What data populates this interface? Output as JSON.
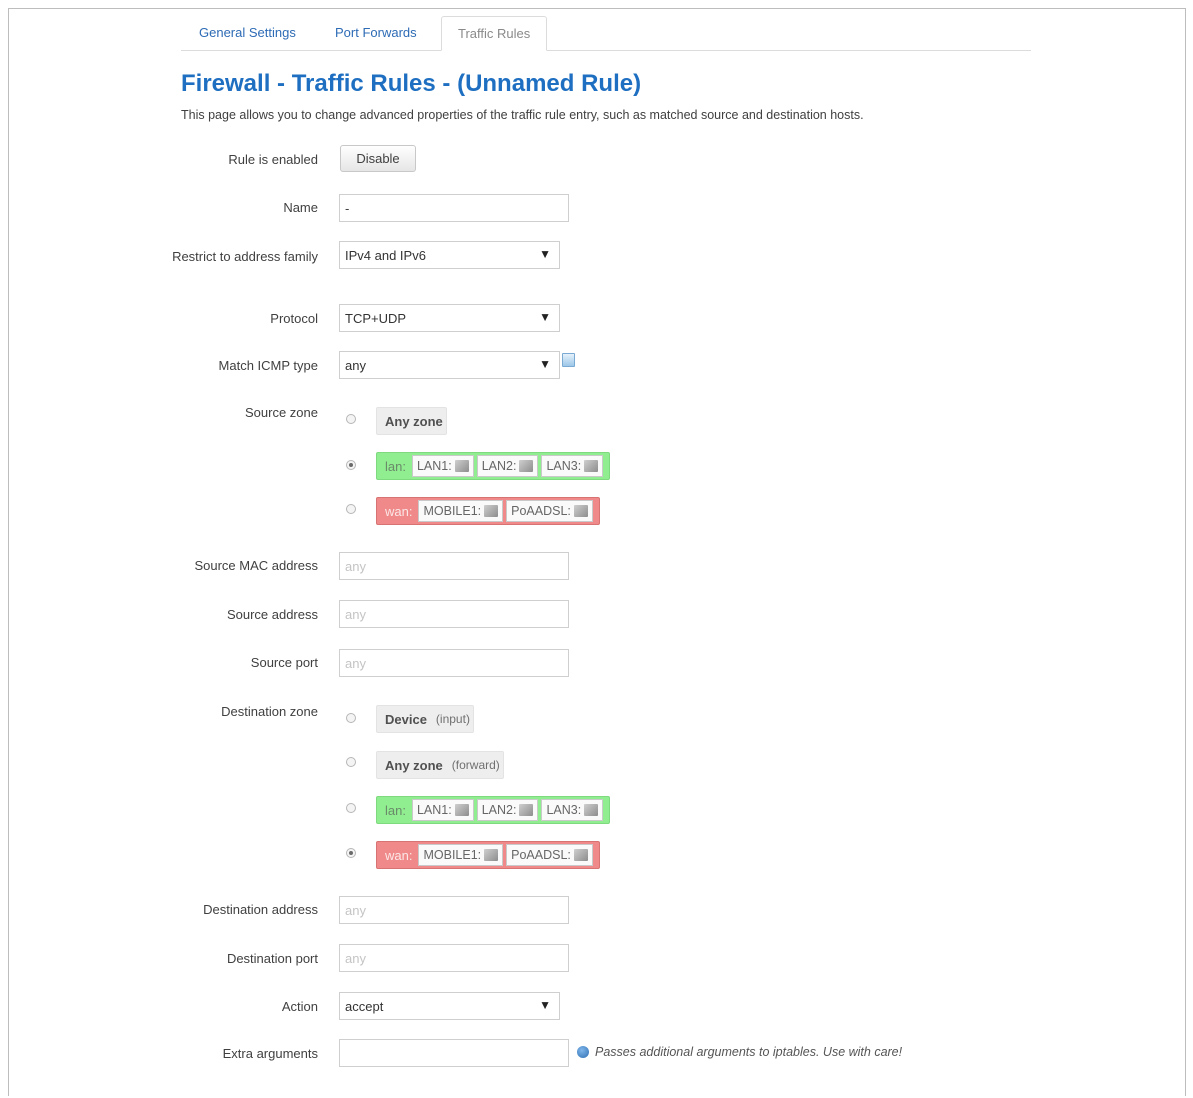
{
  "tabs": [
    {
      "label": "General Settings"
    },
    {
      "label": "Port Forwards"
    },
    {
      "label": "Traffic Rules"
    }
  ],
  "page": {
    "title": "Firewall - Traffic Rules - (Unnamed Rule)",
    "description": "This page allows you to change advanced properties of the traffic rule entry, such as matched source and destination hosts."
  },
  "form": {
    "enabled": {
      "label": "Rule is enabled",
      "button": "Disable"
    },
    "name": {
      "label": "Name",
      "value": "-"
    },
    "family": {
      "label": "Restrict to address family",
      "value": "IPv4 and IPv6"
    },
    "protocol": {
      "label": "Protocol",
      "value": "TCP+UDP"
    },
    "icmp": {
      "label": "Match ICMP type",
      "value": "any"
    },
    "src_zone": {
      "label": "Source zone",
      "any": "Any zone",
      "lan": {
        "name": "lan:",
        "networks": [
          "LAN1:",
          "LAN2:",
          "LAN3:"
        ]
      },
      "wan": {
        "name": "wan:",
        "networks": [
          "MOBILE1:",
          "PoAADSL:"
        ]
      },
      "selected": "lan"
    },
    "src_mac": {
      "label": "Source MAC address",
      "placeholder": "any"
    },
    "src_addr": {
      "label": "Source address",
      "placeholder": "any"
    },
    "src_port": {
      "label": "Source port",
      "placeholder": "any"
    },
    "dest_zone": {
      "label": "Destination zone",
      "device": "Device",
      "device_note": "(input)",
      "any": "Any zone",
      "any_note": "(forward)",
      "lan": {
        "name": "lan:",
        "networks": [
          "LAN1:",
          "LAN2:",
          "LAN3:"
        ]
      },
      "wan": {
        "name": "wan:",
        "networks": [
          "MOBILE1:",
          "PoAADSL:"
        ]
      },
      "selected": "wan"
    },
    "dest_addr": {
      "label": "Destination address",
      "placeholder": "any"
    },
    "dest_port": {
      "label": "Destination port",
      "placeholder": "any"
    },
    "action": {
      "label": "Action",
      "value": "accept"
    },
    "extra": {
      "label": "Extra arguments",
      "value": "",
      "hint": "Passes additional arguments to iptables. Use with care!"
    }
  },
  "icons": {
    "dropdown": "▼",
    "help": "help-book-icon",
    "info": "info-icon",
    "network": "network-interface-icon"
  }
}
